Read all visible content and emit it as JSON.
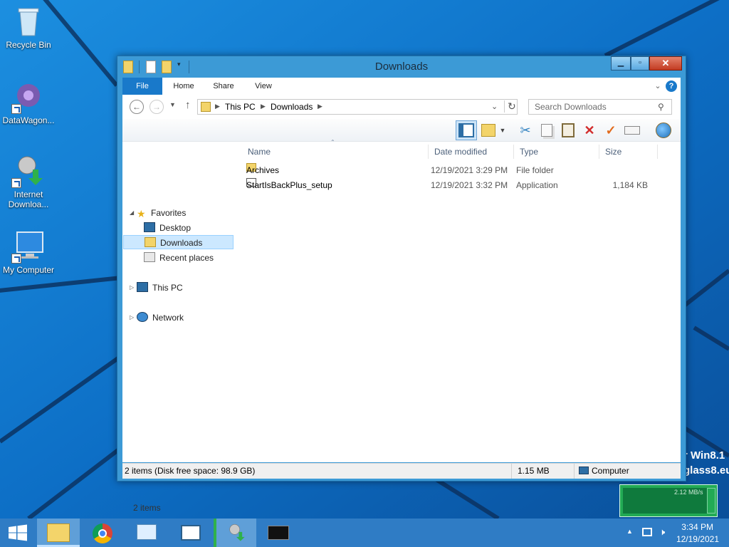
{
  "desktop": {
    "icons": [
      {
        "label": "Recycle Bin",
        "icon": "recycle-bin-icon"
      },
      {
        "label": "DataWagon...",
        "icon": "datawagon-icon"
      },
      {
        "label": "Internet Downloa...",
        "icon": "internet-download-manager-icon"
      },
      {
        "label": "My Computer",
        "icon": "my-computer-icon"
      }
    ],
    "watermark": {
      "line1": "r Win8.1",
      "line2": "glass8.eu"
    }
  },
  "window": {
    "title": "Downloads",
    "tabs": [
      "File",
      "Home",
      "Share",
      "View"
    ],
    "address": {
      "segments": [
        "This PC",
        "Downloads"
      ]
    },
    "search": {
      "placeholder": "Search Downloads"
    },
    "nav": {
      "favorites": "Favorites",
      "desktop": "Desktop",
      "downloads": "Downloads",
      "recent": "Recent places",
      "this_pc": "This PC",
      "network": "Network"
    },
    "columns": [
      "Name",
      "Date modified",
      "Type",
      "Size"
    ],
    "files": [
      {
        "name": "Archives",
        "date": "12/19/2021 3:29 PM",
        "type": "File folder",
        "size": ""
      },
      {
        "name": "StartIsBackPlus_setup",
        "date": "12/19/2021 3:32 PM",
        "type": "Application",
        "size": "1,184 KB"
      }
    ],
    "item_count": "2 items",
    "status": {
      "summary": "2 items (Disk free space: 98.9 GB)",
      "size": "1.15 MB",
      "location": "Computer"
    }
  },
  "netmeter": {
    "rate": "2.12 MB/s"
  },
  "taskbar": {
    "apps": [
      "file-explorer-icon",
      "chrome-icon",
      "control-panel-icon",
      "reader-icon",
      "internet-download-manager-icon",
      "command-prompt-icon"
    ],
    "clock": {
      "time": "3:34 PM",
      "date": "12/19/2021"
    }
  },
  "colors": {
    "accent": "#1979ca",
    "selection": "#cce8ff",
    "taskbar": "#2f7cc5"
  }
}
